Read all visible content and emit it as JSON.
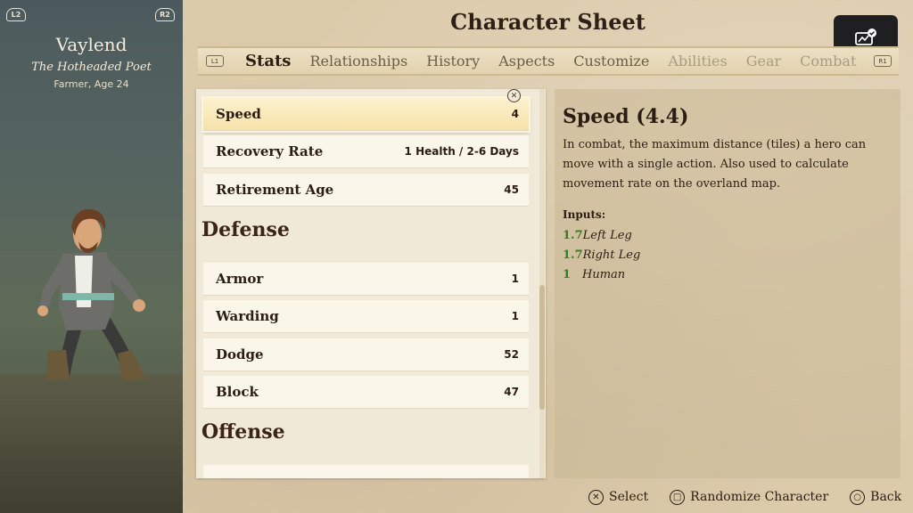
{
  "character": {
    "name": "Vaylend",
    "title": "The Hotheaded Poet",
    "subtitle": "Farmer, Age 24",
    "left_hint": "L2",
    "right_hint": "R2"
  },
  "page": {
    "title": "Character Sheet"
  },
  "tabs": {
    "left_hint": "L1",
    "right_hint": "R1",
    "items": [
      {
        "label": "Stats",
        "state": "active"
      },
      {
        "label": "Relationships",
        "state": "normal"
      },
      {
        "label": "History",
        "state": "normal"
      },
      {
        "label": "Aspects",
        "state": "normal"
      },
      {
        "label": "Customize",
        "state": "normal"
      },
      {
        "label": "Abilities",
        "state": "disabled"
      },
      {
        "label": "Gear",
        "state": "disabled"
      },
      {
        "label": "Combat",
        "state": "disabled"
      }
    ]
  },
  "share": {
    "icon": "share-screenshot-icon"
  },
  "stats": {
    "rows": [
      {
        "label": "Speed",
        "value": "4",
        "selected": true
      },
      {
        "label": "Recovery Rate",
        "value": "1 Health / 2-6 Days"
      },
      {
        "label": "Retirement Age",
        "value": "45"
      }
    ],
    "sections": [
      {
        "title": "Defense",
        "rows": [
          {
            "label": "Armor",
            "value": "1"
          },
          {
            "label": "Warding",
            "value": "1"
          },
          {
            "label": "Dodge",
            "value": "52"
          },
          {
            "label": "Block",
            "value": "47"
          }
        ]
      },
      {
        "title": "Offense",
        "rows": []
      }
    ]
  },
  "detail": {
    "title": "Speed (4.4)",
    "description": "In combat, the maximum distance (tiles) a hero can move with a single action. Also used to calculate movement rate on the overland map.",
    "inputs_label": "Inputs:",
    "inputs": [
      {
        "value": "1.7",
        "name": "Left Leg"
      },
      {
        "value": "1.7",
        "name": "Right Leg"
      },
      {
        "value": "1",
        "name": "Human"
      }
    ]
  },
  "footer": {
    "select": {
      "label": "Select",
      "icon": "cross-button-icon"
    },
    "randomize": {
      "label": "Randomize Character",
      "icon": "square-button-icon"
    },
    "back": {
      "label": "Back",
      "icon": "circle-button-icon"
    }
  },
  "colors": {
    "input_value": "#3c7a22",
    "parchment": "#dccbab",
    "selected_row": "#f6e2a8",
    "text": "#2b1d12"
  }
}
